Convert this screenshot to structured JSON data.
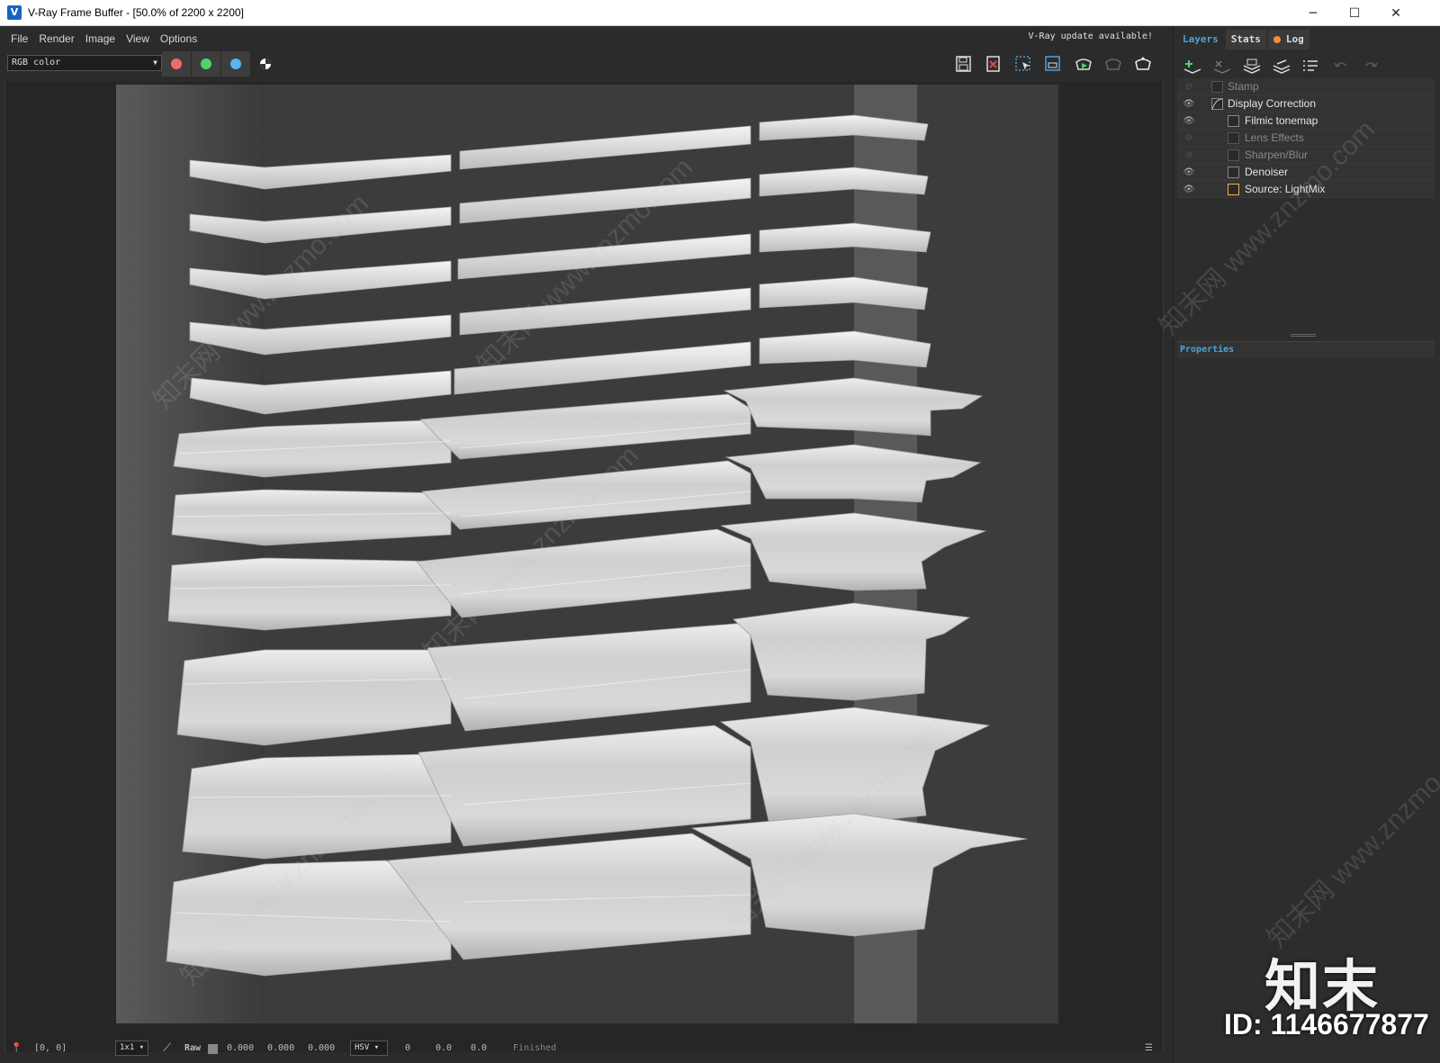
{
  "window": {
    "title": "V-Ray Frame Buffer - [50.0% of 2200 x 2200]",
    "minimize_label": "─",
    "maximize_label": "☐",
    "close_label": "✕"
  },
  "menu": [
    "File",
    "Render",
    "Image",
    "View",
    "Options"
  ],
  "update_notice": "V-Ray update available!",
  "toolbar": {
    "channel": "RGB color",
    "channel_buttons": [
      {
        "name": "red-channel",
        "color": "#f16a6a"
      },
      {
        "name": "green-channel",
        "color": "#4fd36f"
      },
      {
        "name": "blue-channel",
        "color": "#57b7f0"
      }
    ]
  },
  "tabs": {
    "layers": "Layers",
    "stats": "Stats",
    "log": "Log"
  },
  "layers": [
    {
      "label": "Stamp",
      "visible": false,
      "enabled": false,
      "indent": 0,
      "icon": "stamp-icon"
    },
    {
      "label": "Display Correction",
      "visible": true,
      "enabled": true,
      "indent": 0,
      "icon": "curve-icon"
    },
    {
      "label": "Filmic tonemap",
      "visible": true,
      "enabled": true,
      "indent": 1,
      "icon": "tonemap-icon"
    },
    {
      "label": "Lens Effects",
      "visible": false,
      "enabled": false,
      "indent": 1,
      "icon": "lens-icon"
    },
    {
      "label": "Sharpen/Blur",
      "visible": false,
      "enabled": false,
      "indent": 1,
      "icon": "sharpen-icon"
    },
    {
      "label": "Denoiser",
      "visible": true,
      "enabled": true,
      "indent": 1,
      "icon": "denoiser-icon"
    },
    {
      "label": "Source: LightMix",
      "visible": true,
      "enabled": true,
      "indent": 1,
      "icon": "lightmix-icon"
    }
  ],
  "properties_title": "Properties",
  "status": {
    "coords": "[0, 0]",
    "zoom": "1x1",
    "raw_label": "Raw",
    "rgb": [
      "0.000",
      "0.000",
      "0.000"
    ],
    "color_mode": "HSV",
    "hsv": [
      "0",
      "0.0",
      "0.0"
    ],
    "state": "Finished"
  },
  "watermark": {
    "brand": "知末",
    "id": "ID: 1146677877",
    "text": "知末网 www.znzmo.com"
  }
}
